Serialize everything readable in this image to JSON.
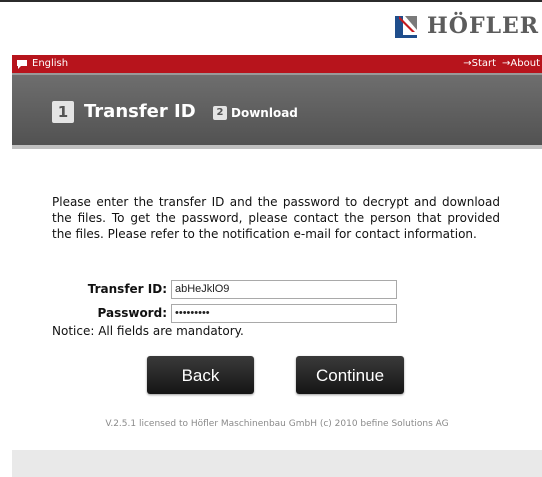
{
  "brand": {
    "name": "HÖFLER",
    "logo_icon": "hofler-logo-icon"
  },
  "topbar": {
    "language": "English",
    "language_icon": "speech-bubble-icon",
    "links": [
      {
        "label": "→Start"
      },
      {
        "label": "→About"
      }
    ]
  },
  "steps": [
    {
      "number": "1",
      "label": "Transfer ID",
      "active": true
    },
    {
      "number": "2",
      "label": "Download",
      "active": false
    }
  ],
  "main": {
    "intro": "Please enter the transfer ID and the password to decrypt and download the files. To get the password, please contact the person that provided the files. Please refer to the notification e-mail for contact information.",
    "form": {
      "transfer_id_label": "Transfer ID:",
      "transfer_id_value": "abHeJklO9",
      "password_label": "Password:",
      "password_value": "•••••••••"
    },
    "notice": "Notice: All fields are mandatory.",
    "back_label": "Back",
    "continue_label": "Continue"
  },
  "footer": {
    "text": "V.2.5.1 licensed to Höfler Maschinenbau GmbH (c) 2010 befine Solutions AG"
  },
  "colors": {
    "accent_red": "#b7141c",
    "header_gray": "#5f5f5f",
    "button_dark": "#222222"
  }
}
